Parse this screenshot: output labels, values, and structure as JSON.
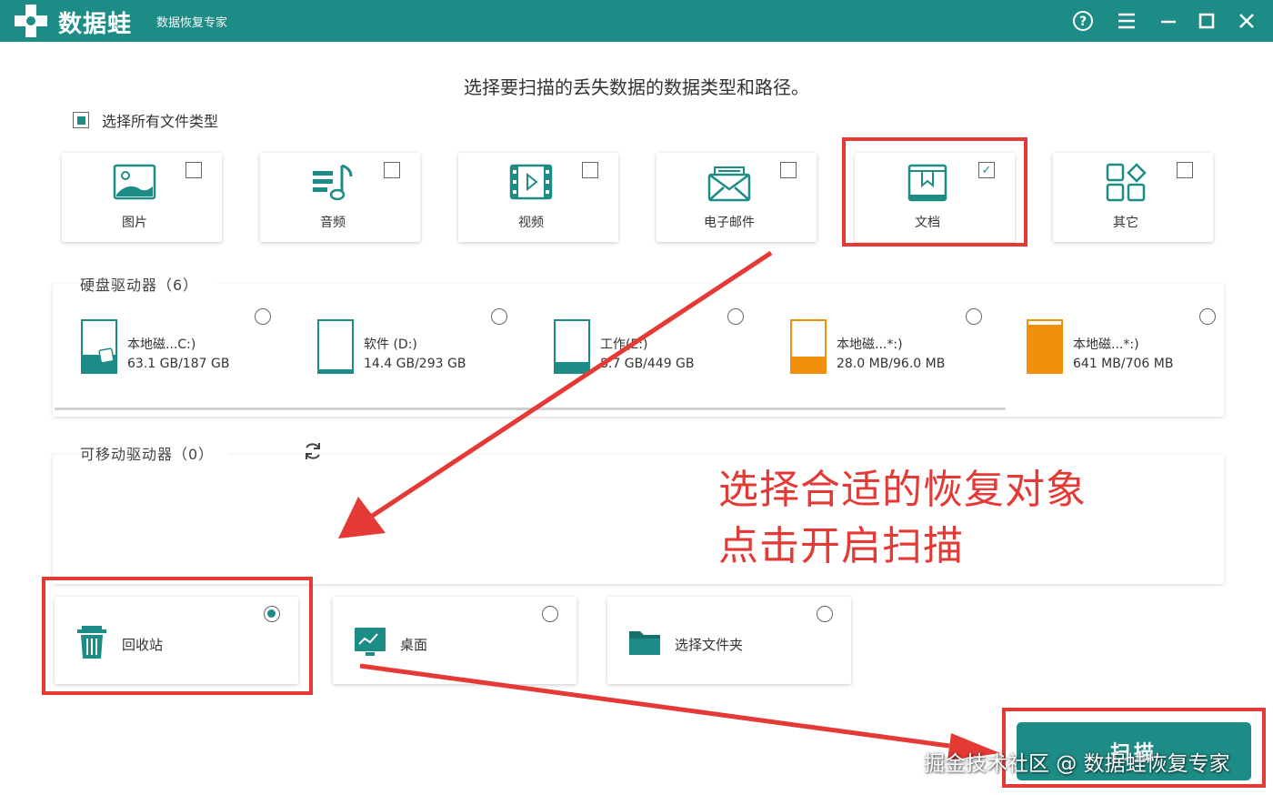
{
  "app": {
    "name": "数据蛙",
    "subtitle": "数据恢复专家"
  },
  "instruction": "选择要扫描的丢失数据的数据类型和路径。",
  "select_all": {
    "label": "选择所有文件类型"
  },
  "file_types": [
    {
      "label": "图片",
      "icon": "image-icon",
      "checked": false
    },
    {
      "label": "音频",
      "icon": "audio-icon",
      "checked": false
    },
    {
      "label": "视频",
      "icon": "video-icon",
      "checked": false
    },
    {
      "label": "电子邮件",
      "icon": "email-icon",
      "checked": false
    },
    {
      "label": "文档",
      "icon": "document-icon",
      "checked": true
    },
    {
      "label": "其它",
      "icon": "other-icon",
      "checked": false
    }
  ],
  "hard_drives": {
    "title": "硬盘驱动器（6）",
    "items": [
      {
        "name": "本地磁...C:)",
        "size": "63.1 GB/187 GB",
        "fill": 0.34,
        "color": "#1e8c86"
      },
      {
        "name": "软件 (D:)",
        "size": "14.4 GB/293 GB",
        "fill": 0.05,
        "color": "#1e8c86"
      },
      {
        "name": "工作(E:)",
        "size": "8.7 GB/449 GB",
        "fill": 0.19,
        "color": "#1e8c86"
      },
      {
        "name": "本地磁...*:)",
        "size": "28.0 MB/96.0 MB",
        "fill": 0.29,
        "color": "#f0900c"
      },
      {
        "name": "本地磁...*:)",
        "size": "641 MB/706 MB",
        "fill": 0.91,
        "color": "#f0900c"
      }
    ]
  },
  "removable": {
    "title": "可移动驱动器（0）"
  },
  "locations": [
    {
      "label": "回收站",
      "icon": "recycle-bin-icon",
      "selected": true
    },
    {
      "label": "桌面",
      "icon": "desktop-icon",
      "selected": false
    },
    {
      "label": "选择文件夹",
      "icon": "folder-icon",
      "selected": false
    }
  ],
  "annotation": {
    "line1": "选择合适的恢复对象",
    "line2": "点击开启扫描",
    "color": "#e53935"
  },
  "scan_button": {
    "label": "扫描"
  },
  "watermark": "掘金技术社区 @ 数据蛙恢复专家",
  "colors": {
    "accent": "#1e8c86",
    "highlight": "#e53935",
    "drive_warning": "#f0900c"
  }
}
